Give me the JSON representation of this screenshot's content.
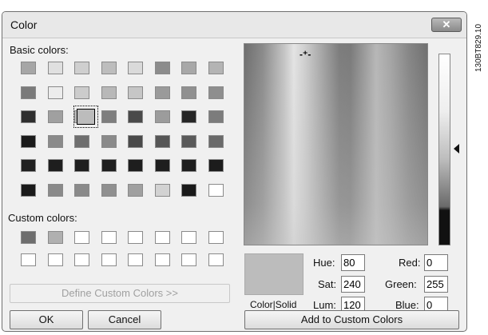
{
  "dialog": {
    "title": "Color",
    "close_glyph": "✕",
    "basic_colors_label": "Basic colors:",
    "custom_colors_label": "Custom colors:",
    "define_custom_label": "Define Custom Colors >>",
    "ok_label": "OK",
    "cancel_label": "Cancel",
    "add_custom_label": "Add to Custom Colors",
    "color_solid_label": "Color|Solid",
    "hue_label": "Hue:",
    "sat_label": "Sat:",
    "lum_label": "Lum:",
    "red_label": "Red:",
    "green_label": "Green:",
    "blue_label": "Blue:",
    "hue_value": "80",
    "sat_value": "240",
    "lum_value": "120",
    "red_value": "0",
    "green_value": "255",
    "blue_value": "0",
    "preview_color": "#bcbcbc",
    "selected_swatch": {
      "row": 2,
      "col": 2
    }
  },
  "basic_colors": [
    [
      "#a6a6a6",
      "#e0e0e0",
      "#cfcfcf",
      "#bdbdbd",
      "#dadada",
      "#8c8c8c",
      "#a8a8a8",
      "#b4b4b4"
    ],
    [
      "#7a7a7a",
      "#ececec",
      "#cccccc",
      "#b8b8b8",
      "#c6c6c6",
      "#9a9a9a",
      "#909090",
      "#8e8e8e"
    ],
    [
      "#2e2e2e",
      "#a0a0a0",
      "#bcbcbc",
      "#7e7e7e",
      "#4a4a4a",
      "#9c9c9c",
      "#262626",
      "#7c7c7c"
    ],
    [
      "#1a1a1a",
      "#8a8a8a",
      "#6e6e6e",
      "#8a8a8a",
      "#4a4a4a",
      "#565656",
      "#5a5a5a",
      "#6a6a6a"
    ],
    [
      "#202020",
      "#1e1e1e",
      "#1e1e1e",
      "#1e1e1e",
      "#1e1e1e",
      "#1e1e1e",
      "#1e1e1e",
      "#1c1c1c"
    ],
    [
      "#1a1a1a",
      "#8a8a8a",
      "#8a8a8a",
      "#909090",
      "#a0a0a0",
      "#d2d2d2",
      "#1a1a1a",
      "#ffffff"
    ]
  ],
  "custom_colors": [
    [
      "#6e6e6e",
      "#b0b0b0",
      "#ffffff",
      "#ffffff",
      "#ffffff",
      "#ffffff",
      "#ffffff",
      "#ffffff"
    ],
    [
      "#ffffff",
      "#ffffff",
      "#ffffff",
      "#ffffff",
      "#ffffff",
      "#ffffff",
      "#ffffff",
      "#ffffff"
    ]
  ],
  "figure_code": "130BT829.10"
}
